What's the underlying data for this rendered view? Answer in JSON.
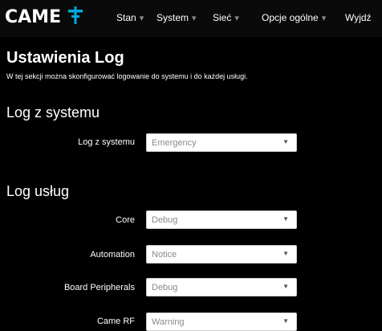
{
  "brand": {
    "logo_text": "CAME",
    "accent_color": "#00a9e0"
  },
  "nav": {
    "items": [
      {
        "label": "Stan",
        "has_caret": true
      },
      {
        "label": "System",
        "has_caret": true
      },
      {
        "label": "Sieć",
        "has_caret": true
      },
      {
        "label": "Opcje ogólne",
        "has_caret": true
      },
      {
        "label": "Wyjdź",
        "has_caret": false
      }
    ],
    "caret_glyph": "▾"
  },
  "page": {
    "title": "Ustawienia Log",
    "description": "W tej sekcji można skonfigurować logowanie do systemu i do każdej usługi."
  },
  "system_log": {
    "heading": "Log z systemu",
    "label": "Log z systemu",
    "value": "Emergency"
  },
  "service_log": {
    "heading": "Log usług",
    "rows": [
      {
        "label": "Core",
        "value": "Debug"
      },
      {
        "label": "Automation",
        "value": "Notice"
      },
      {
        "label": "Board Peripherals",
        "value": "Debug"
      },
      {
        "label": "Came RF",
        "value": "Warning"
      }
    ]
  },
  "select_arrow_glyph": "▼"
}
